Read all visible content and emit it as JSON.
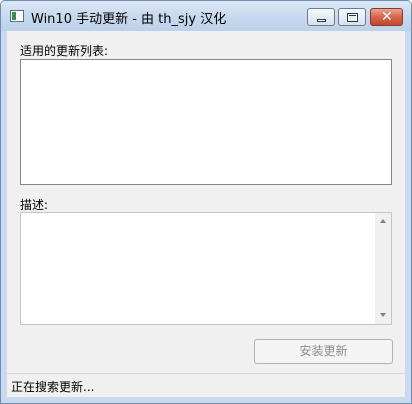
{
  "window": {
    "title": "Win10 手动更新 - 由 th_sjy 汉化",
    "icon": "app-window-icon",
    "minimize_icon": "minimize-icon",
    "maximize_icon": "maximize-icon",
    "close_icon": "close-icon",
    "close_glyph": "✕"
  },
  "updates": {
    "label": "适用的更新列表:",
    "items": []
  },
  "description": {
    "label": "描述:",
    "text": ""
  },
  "buttons": {
    "install_label": "安装更新"
  },
  "status": {
    "text": "正在搜索更新..."
  },
  "colors": {
    "frame": "#c9daee",
    "client": "#f0f0f0",
    "close_button": "#c5442d"
  }
}
